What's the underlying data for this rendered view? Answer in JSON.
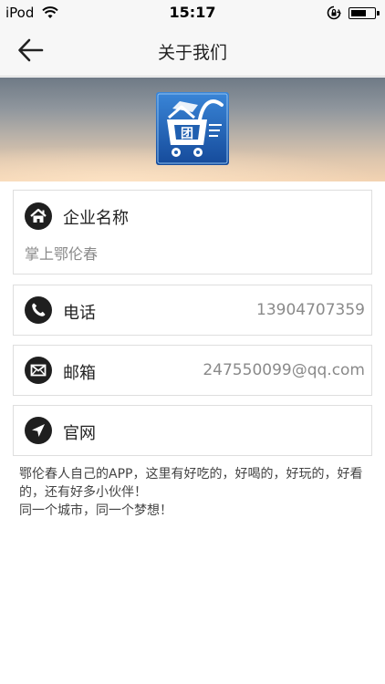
{
  "status_bar": {
    "carrier": "iPod",
    "time": "15:17",
    "battery_level": 0.65
  },
  "nav": {
    "title": "关于我们",
    "back_icon": "arrow-left-icon"
  },
  "banner": {
    "logo_icon": "app-logo-shopping-cart"
  },
  "company": {
    "label": "企业名称",
    "value": "掌上鄂伦春",
    "icon": "home-icon"
  },
  "phone": {
    "label": "电话",
    "value": "13904707359",
    "icon": "phone-icon"
  },
  "email": {
    "label": "邮箱",
    "value": "247550099@qq.com",
    "icon": "mail-icon"
  },
  "website": {
    "label": "官网",
    "icon": "location-arrow-icon"
  },
  "description": {
    "line1": "鄂伦春人自己的APP，这里有好吃的，好喝的，好玩的，好看的，还有好多小伙伴！",
    "line2": "同一个城市，同一个梦想！"
  },
  "colors": {
    "icon_circle": "#1f1f1f",
    "value_text": "#8a8a8a",
    "logo_blue": "#1f5fb0"
  }
}
